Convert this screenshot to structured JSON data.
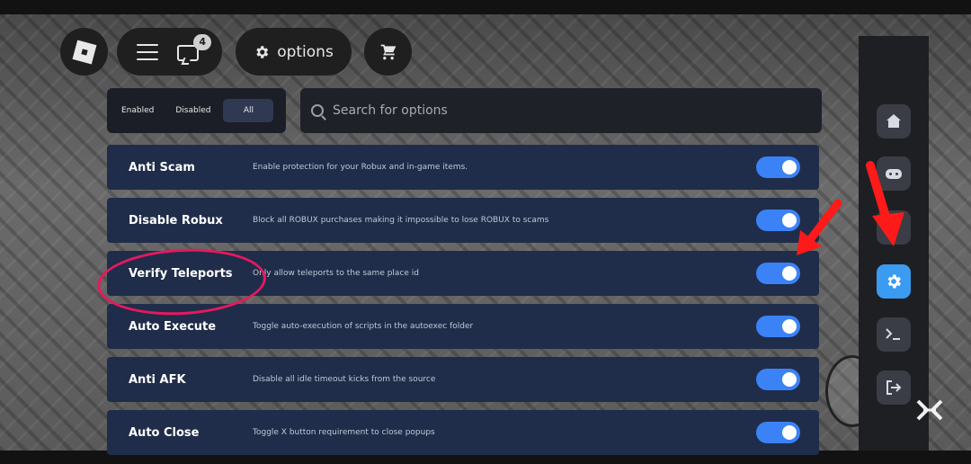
{
  "topbar": {
    "chat_badge": "4",
    "options_label": "options"
  },
  "filters": {
    "enabled": "Enabled",
    "disabled": "Disabled",
    "all": "All",
    "active": "All"
  },
  "search": {
    "placeholder": "Search for options"
  },
  "options": [
    {
      "title": "Anti Scam",
      "description": "Enable protection for your Robux and in-game items.",
      "enabled": true
    },
    {
      "title": "Disable Robux",
      "description": "Block all ROBUX purchases making it impossible to lose ROBUX to scams",
      "enabled": true
    },
    {
      "title": "Verify Teleports",
      "description": "Only allow teleports to the same place id",
      "enabled": true
    },
    {
      "title": "Auto Execute",
      "description": "Toggle auto-execution of scripts in the autoexec folder",
      "enabled": true
    },
    {
      "title": "Anti AFK",
      "description": "Disable all idle timeout kicks from the source",
      "enabled": true
    },
    {
      "title": "Auto Close",
      "description": "Toggle X button requirement to close popups",
      "enabled": true
    }
  ],
  "right_panel": {
    "items": [
      {
        "icon": "home-icon"
      },
      {
        "icon": "gamepad-icon"
      },
      {
        "icon": "unknown-icon"
      },
      {
        "icon": "gear-icon",
        "active": true
      },
      {
        "icon": "terminal-icon"
      },
      {
        "icon": "exit-icon"
      }
    ]
  },
  "colors": {
    "accent": "#3b82f6",
    "row_bg": "#1f2d4a",
    "annotation": "#e8185d",
    "arrow": "#ff1a1a"
  }
}
